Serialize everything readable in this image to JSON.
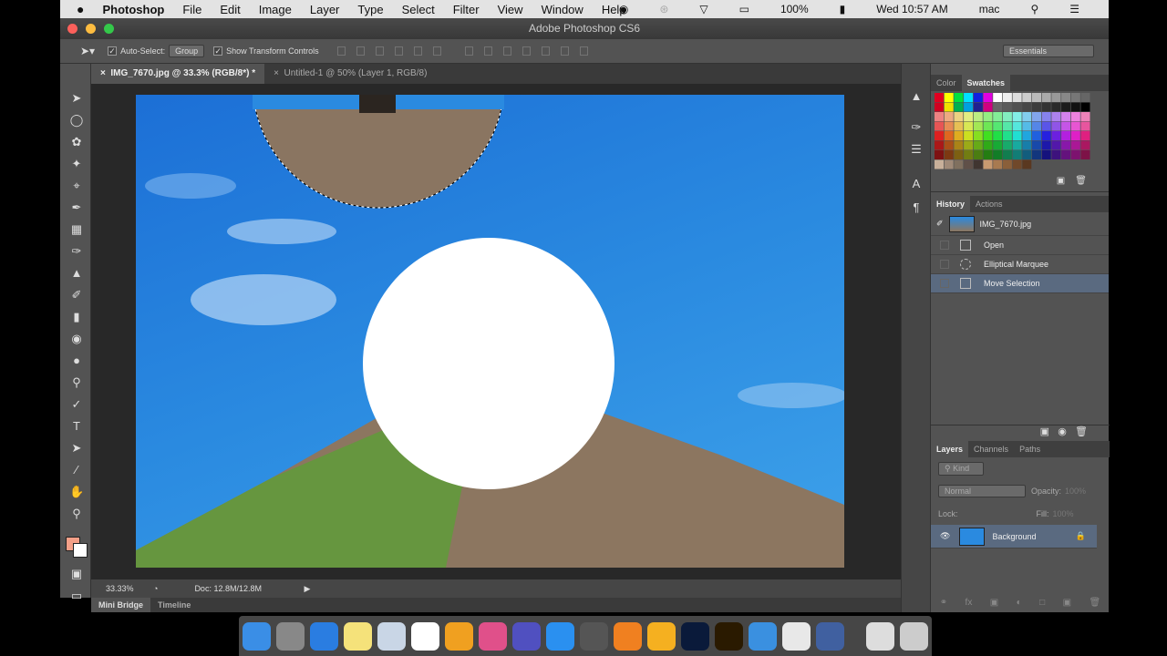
{
  "menubar": {
    "app": "Photoshop",
    "items": [
      "File",
      "Edit",
      "Image",
      "Layer",
      "Type",
      "Select",
      "Filter",
      "View",
      "Window",
      "Help"
    ],
    "battery": "100%",
    "clock": "Wed 10:57 AM",
    "user": "mac"
  },
  "titlebar": {
    "title": "Adobe Photoshop CS6"
  },
  "options": {
    "auto_select": "Auto-Select:",
    "auto_select_value": "Group",
    "show_transform": "Show Transform Controls",
    "workspace": "Essentials"
  },
  "tabs": [
    {
      "label": "IMG_7670.jpg @ 33.3% (RGB/8*) *"
    },
    {
      "label": "Untitled-1 @ 50% (Layer 1, RGB/8)"
    }
  ],
  "status": {
    "zoom": "33.33%",
    "doc": "Doc: 12.8M/12.8M"
  },
  "bottom_tabs": [
    "Mini Bridge",
    "Timeline"
  ],
  "swatches_panel": {
    "tabs": [
      "Color",
      "Swatches"
    ]
  },
  "history_panel": {
    "tabs": [
      "History",
      "Actions"
    ],
    "snapshot": "IMG_7670.jpg",
    "items": [
      "Open",
      "Elliptical Marquee",
      "Move Selection"
    ]
  },
  "layers_panel": {
    "tabs": [
      "Layers",
      "Channels",
      "Paths"
    ],
    "filter": "Kind",
    "blend": "Normal",
    "opacity_label": "Opacity:",
    "opacity": "100%",
    "lock_label": "Lock:",
    "fill_label": "Fill:",
    "fill": "100%",
    "layers": [
      {
        "name": "Background"
      }
    ]
  },
  "colors": {
    "foreground": "#f4a088",
    "background": "#ffffff",
    "accent_selection": "#5a6a80"
  }
}
